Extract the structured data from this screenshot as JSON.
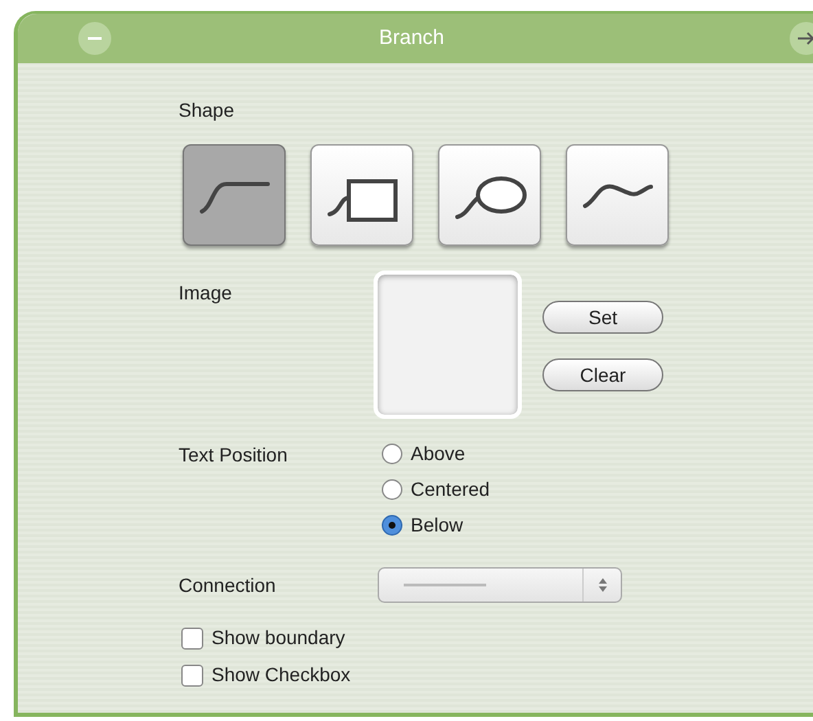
{
  "window": {
    "title": "Branch"
  },
  "shape": {
    "label": "Shape",
    "options": [
      {
        "kind": "line",
        "selected": true
      },
      {
        "kind": "rectangle",
        "selected": false
      },
      {
        "kind": "ellipse",
        "selected": false
      },
      {
        "kind": "wave",
        "selected": false
      }
    ]
  },
  "image": {
    "label": "Image",
    "buttons": [
      "Set",
      "Clear"
    ]
  },
  "text_position": {
    "label": "Text Position",
    "options": [
      {
        "label": "Above",
        "selected": false
      },
      {
        "label": "Centered",
        "selected": false
      },
      {
        "label": "Below",
        "selected": true
      }
    ]
  },
  "connection": {
    "label": "Connection"
  },
  "checkboxes": [
    {
      "label": "Show boundary",
      "checked": false
    },
    {
      "label": "Show Checkbox",
      "checked": false
    }
  ]
}
